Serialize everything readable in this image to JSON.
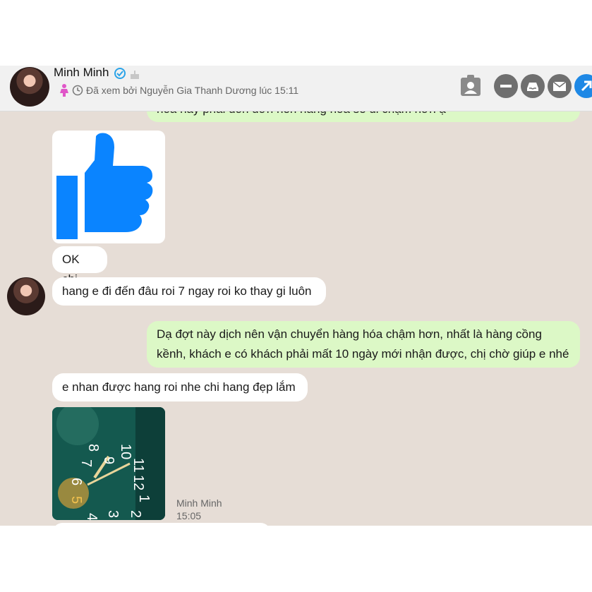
{
  "header": {
    "name": "Minh Minh",
    "seen_text": "Đã xem bởi Nguyễn Gia Thanh Dương lúc 15:11"
  },
  "messages": [
    {
      "text": "hóa này phải dồn đơn nên hàng hóa sẽ đi chậm hơn ạ"
    },
    {
      "text": "OK chi"
    },
    {
      "text": "hang e đi đến đâu roi 7 ngay roi ko thay gi luôn"
    },
    {
      "line1": "Dạ đợt này dịch nên vận chuyển hàng hóa chậm hơn, nhất là hàng cồng",
      "line2": "kềnh, khách e có khách phải mất 10 ngày mới nhận được, chị chờ giúp e nhé"
    },
    {
      "text": "e nhan được hang roi nhe chi hang đẹp lắm"
    }
  ],
  "photo": {
    "sender": "Minh Minh",
    "time": "15:05"
  },
  "colors": {
    "chat_background": "#e6ddd6",
    "incoming_bubble": "#ffffff",
    "outgoing_bubble": "#dcf8c6",
    "like_blue": "#0a84ff",
    "action_blue": "#1e88e5"
  }
}
